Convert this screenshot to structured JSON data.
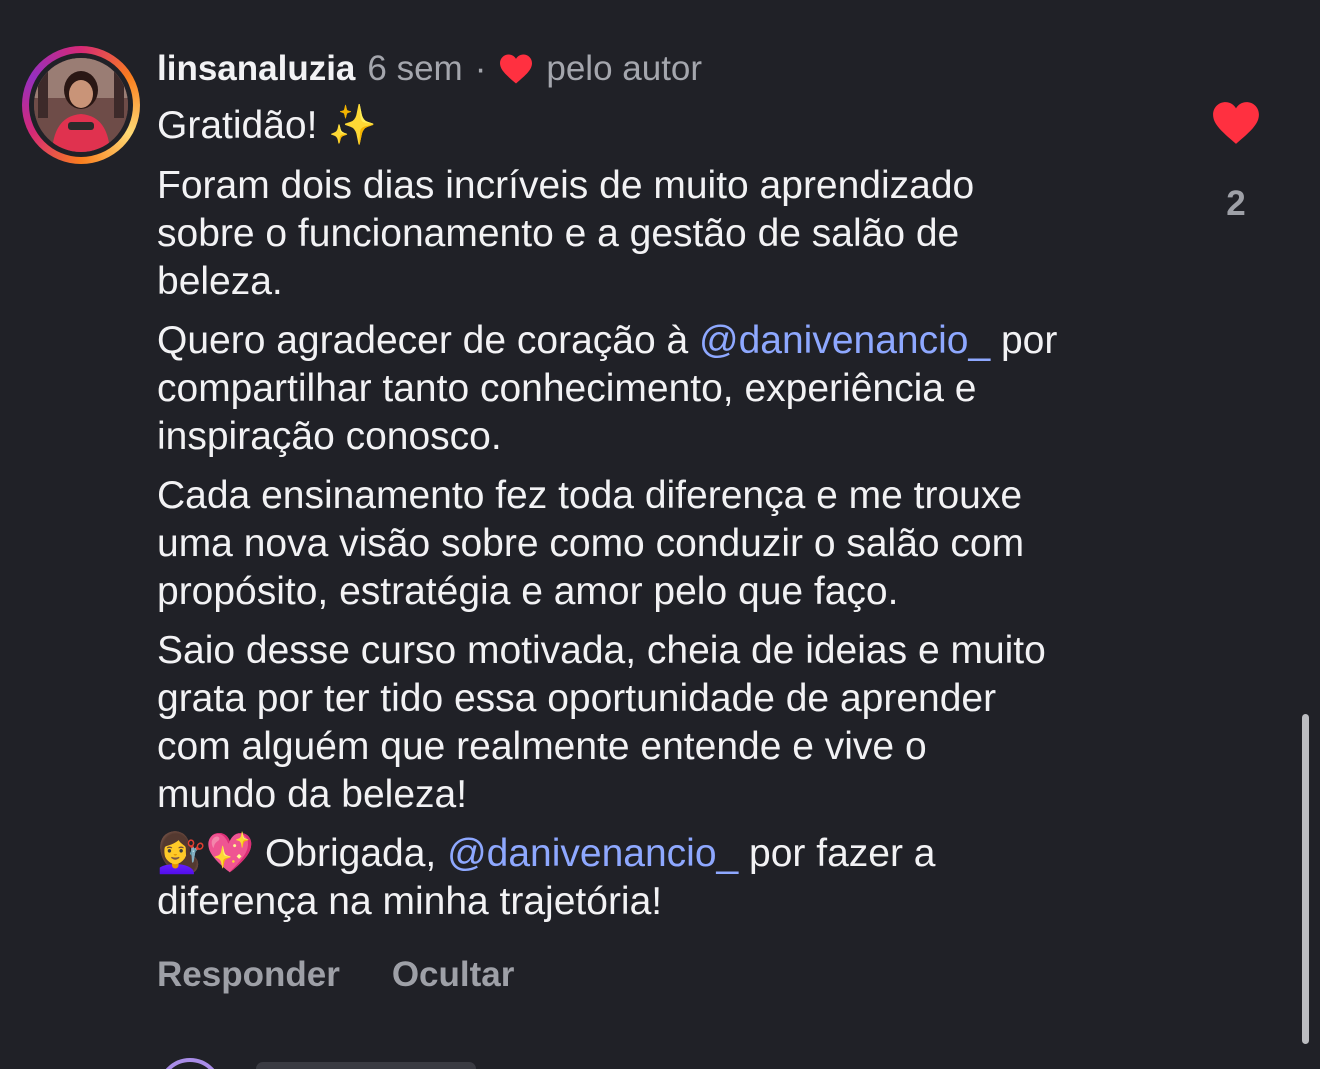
{
  "comment": {
    "username": "linsanaluzia",
    "time": "6 sem",
    "separator": "·",
    "liked_by_author_label": "pelo autor",
    "heart_icon": "heart-filled-icon",
    "heart_color": "#ff3040",
    "paragraphs": {
      "p1": "Gratidão! ✨",
      "p2": "Foram dois dias incríveis de muito aprendizado\nsobre o funcionamento e a gestão de salão de\nbeleza.",
      "p3_a": "Quero agradecer de coração à ",
      "p3_mention": "@danivenancio_",
      "p3_b": " por\ncompartilhar tanto conhecimento, experiência e\ninspiração conosco.",
      "p4": "Cada ensinamento fez toda diferença e me trouxe\numa nova visão sobre como conduzir o salão com\npropósito, estratégia e amor pelo que faço.",
      "p5": "Saio desse curso motivada, cheia de ideias e muito\ngrata por ter tido essa oportunidade de aprender\ncom alguém que realmente entende e vive o\nmundo da beleza!",
      "p6_emoji": "💇‍♀️💖",
      "p6_a": " Obrigada, ",
      "p6_mention": "@danivenancio_",
      "p6_b": " por fazer a\ndiferença na minha trajetória!"
    },
    "mention_color": "#8ea8ff",
    "actions": {
      "reply_label": "Responder",
      "hide_label": "Ocultar"
    },
    "likes": {
      "count": "2",
      "icon": "heart-filled-icon"
    }
  },
  "colors": {
    "background": "#202127",
    "text_primary": "#f2f2f4",
    "text_secondary": "#a4a6ad"
  }
}
